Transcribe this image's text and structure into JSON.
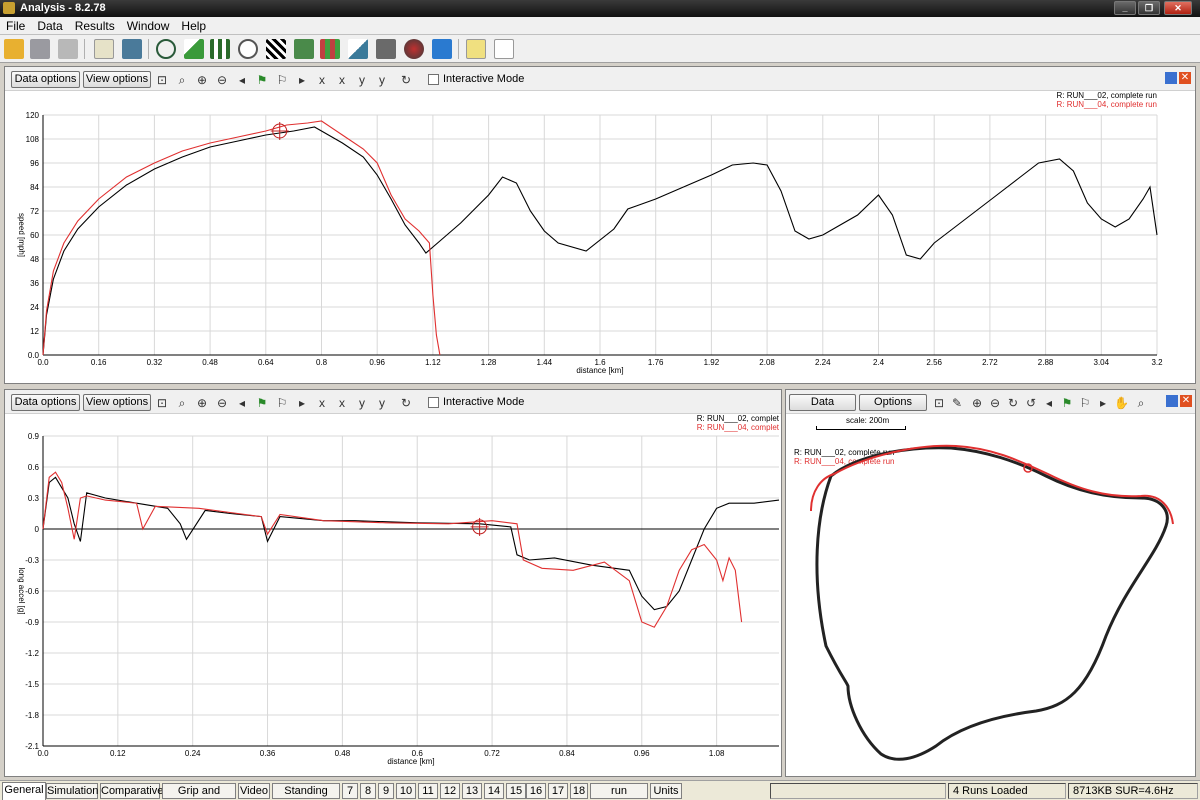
{
  "window": {
    "title": "Analysis - 8.2.78"
  },
  "menu": [
    "File",
    "Data",
    "Results",
    "Window",
    "Help"
  ],
  "panel_top": {
    "data_options_label": "Data options",
    "view_options_label": "View options",
    "interactive_label": "Interactive Mode",
    "legend": [
      "R:  RUN___02, complete run",
      "R:  RUN___04, complete run"
    ]
  },
  "panel_bottom_left": {
    "data_options_label": "Data options",
    "view_options_label": "View options",
    "interactive_label": "Interactive Mode",
    "legend": [
      "R:  RUN___02, complet",
      "R:  RUN___04, complet"
    ]
  },
  "panel_map": {
    "data_label": "Data",
    "options_label": "Options",
    "scale_label": "scale: 200m",
    "legend": [
      "R:  RUN___02, complete run",
      "R:  RUN___04, complete run"
    ]
  },
  "colors": {
    "run02": "#000000",
    "run04": "#e03030",
    "accent": "#3a6ea5"
  },
  "chart_data": [
    {
      "type": "line",
      "title": "",
      "xlabel": "distance [km]",
      "ylabel": "speed  [mph]",
      "xlim": [
        0,
        3.2
      ],
      "ylim": [
        0,
        120
      ],
      "x_ticks": [
        "0.0",
        "0.16",
        "0.32",
        "0.48",
        "0.64",
        "0.8",
        "0.96",
        "1.12",
        "1.28",
        "1.44",
        "1.6",
        "1.76",
        "1.92",
        "2.08",
        "2.24",
        "2.4",
        "2.56",
        "2.72",
        "2.88",
        "3.04",
        "3.2"
      ],
      "y_ticks": [
        "0.0",
        "12",
        "24",
        "36",
        "48",
        "60",
        "72",
        "84",
        "96",
        "108",
        "120"
      ],
      "grid": true,
      "legend_position": "top-right",
      "series": [
        {
          "name": "R:  RUN___02, complete run",
          "color": "#000000",
          "x": [
            0,
            0.01,
            0.03,
            0.06,
            0.1,
            0.16,
            0.24,
            0.32,
            0.4,
            0.48,
            0.56,
            0.64,
            0.72,
            0.78,
            0.8,
            0.86,
            0.92,
            0.96,
            1.0,
            1.04,
            1.08,
            1.1,
            1.14,
            1.2,
            1.28,
            1.32,
            1.36,
            1.4,
            1.44,
            1.48,
            1.56,
            1.64,
            1.68,
            1.76,
            1.84,
            1.92,
            1.98,
            2.04,
            2.08,
            2.12,
            2.16,
            2.2,
            2.24,
            2.28,
            2.34,
            2.4,
            2.44,
            2.48,
            2.52,
            2.56,
            2.62,
            2.68,
            2.74,
            2.8,
            2.86,
            2.92,
            2.96,
            3.0,
            3.04,
            3.08,
            3.12,
            3.16,
            3.18,
            3.2
          ],
          "y": [
            0,
            20,
            38,
            52,
            63,
            74,
            85,
            93,
            99,
            104,
            107,
            110,
            112,
            114,
            112,
            106,
            99,
            90,
            78,
            65,
            56,
            51,
            57,
            66,
            80,
            89,
            86,
            72,
            62,
            56,
            52,
            63,
            73,
            78,
            84,
            90,
            95,
            96,
            95,
            82,
            62,
            58,
            60,
            64,
            70,
            80,
            70,
            50,
            48,
            56,
            64,
            72,
            80,
            88,
            96,
            98,
            92,
            76,
            68,
            64,
            68,
            78,
            84,
            60
          ]
        },
        {
          "name": "R:  RUN___04, complete run",
          "color": "#e03030",
          "x": [
            0,
            0.01,
            0.03,
            0.06,
            0.1,
            0.16,
            0.24,
            0.32,
            0.4,
            0.48,
            0.56,
            0.64,
            0.7,
            0.76,
            0.8,
            0.86,
            0.92,
            0.96,
            1.0,
            1.04,
            1.08,
            1.11,
            1.12,
            1.13,
            1.14
          ],
          "y": [
            0,
            22,
            42,
            56,
            67,
            78,
            89,
            96,
            102,
            106,
            109,
            112,
            115,
            116,
            117,
            110,
            103,
            96,
            80,
            68,
            62,
            56,
            30,
            10,
            0
          ]
        }
      ]
    },
    {
      "type": "line",
      "title": "",
      "xlabel": "distance [km]",
      "ylabel": "long accel [g]",
      "xlim": [
        0,
        1.18
      ],
      "ylim": [
        -2.1,
        0.9
      ],
      "x_ticks": [
        "0.0",
        "0.12",
        "0.24",
        "0.36",
        "0.48",
        "0.6",
        "0.72",
        "0.84",
        "0.96",
        "1.08"
      ],
      "y_ticks": [
        "0.9",
        "0.6",
        "0.3",
        "0",
        "-0.3",
        "-0.6",
        "-0.9",
        "-1.2",
        "-1.5",
        "-1.8",
        "-2.1"
      ],
      "grid": true,
      "legend_position": "top-right",
      "series": [
        {
          "name": "R:  RUN___02, complet",
          "color": "#000000",
          "x": [
            0,
            0.01,
            0.02,
            0.03,
            0.04,
            0.05,
            0.06,
            0.07,
            0.1,
            0.15,
            0.2,
            0.22,
            0.23,
            0.26,
            0.3,
            0.35,
            0.36,
            0.38,
            0.45,
            0.5,
            0.6,
            0.7,
            0.75,
            0.76,
            0.78,
            0.82,
            0.88,
            0.94,
            0.96,
            0.98,
            1.0,
            1.02,
            1.04,
            1.06,
            1.08,
            1.1,
            1.14,
            1.18
          ],
          "y": [
            0,
            0.45,
            0.5,
            0.4,
            0.3,
            0.05,
            -0.12,
            0.35,
            0.3,
            0.25,
            0.2,
            0.05,
            -0.1,
            0.18,
            0.15,
            0.12,
            -0.12,
            0.12,
            0.08,
            0.08,
            0.06,
            0.05,
            0.02,
            -0.25,
            -0.3,
            -0.28,
            -0.35,
            -0.4,
            -0.65,
            -0.78,
            -0.75,
            -0.6,
            -0.3,
            0.0,
            0.2,
            0.25,
            0.25,
            0.28
          ]
        },
        {
          "name": "R:  RUN___04, complet",
          "color": "#e03030",
          "x": [
            0,
            0.01,
            0.02,
            0.03,
            0.04,
            0.05,
            0.06,
            0.07,
            0.1,
            0.15,
            0.16,
            0.18,
            0.25,
            0.3,
            0.35,
            0.36,
            0.38,
            0.45,
            0.55,
            0.65,
            0.72,
            0.76,
            0.77,
            0.8,
            0.85,
            0.9,
            0.94,
            0.96,
            0.98,
            1.0,
            1.02,
            1.04,
            1.06,
            1.08,
            1.09,
            1.1,
            1.11,
            1.12
          ],
          "y": [
            0,
            0.5,
            0.55,
            0.45,
            0.2,
            -0.1,
            0.3,
            0.32,
            0.28,
            0.25,
            0.0,
            0.22,
            0.2,
            0.16,
            0.12,
            -0.05,
            0.14,
            0.08,
            0.06,
            0.05,
            0.08,
            0.05,
            -0.3,
            -0.38,
            -0.4,
            -0.32,
            -0.5,
            -0.9,
            -0.95,
            -0.75,
            -0.4,
            -0.2,
            -0.15,
            -0.3,
            -0.5,
            -0.28,
            -0.4,
            -0.9
          ]
        }
      ]
    }
  ]
}
